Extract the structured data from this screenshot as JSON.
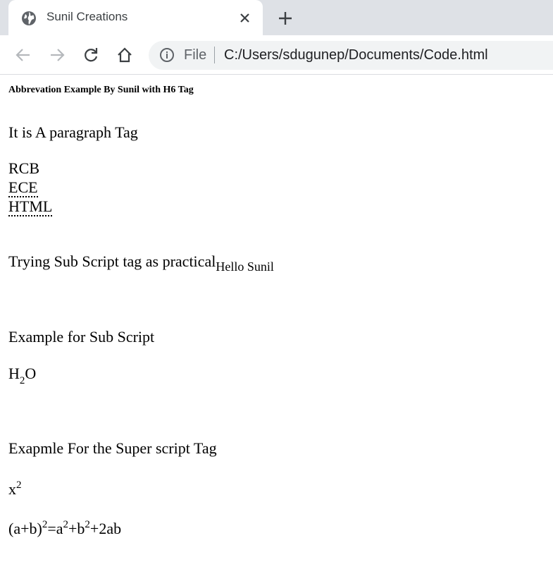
{
  "browser": {
    "tab_title": "Sunil Creations",
    "omnibox_scheme_label": "File",
    "url": "C:/Users/sdugunep/Documents/Code.html"
  },
  "page": {
    "heading_h6": "Abbrevation Example By Sunil with H6 Tag",
    "paragraph": "It is A paragraph Tag",
    "abbr_lines": [
      "RCB",
      "ECE",
      "HTML"
    ],
    "subscript_demo": {
      "text": "Trying Sub Script tag as practical",
      "sub": "Hello Sunil"
    },
    "sub_example_title": "Example for Sub Script",
    "h2o": {
      "h": "H",
      "sub": "2",
      "o": "O"
    },
    "sup_example_title": "Exapmle For the Super script Tag",
    "x_squared": {
      "base": "x",
      "sup": "2"
    },
    "formula": {
      "part1": "(a+b)",
      "sup1": "2",
      "part2": "=a",
      "sup2": "2",
      "part3": "+b",
      "sup3": "2",
      "part4": "+2ab"
    }
  }
}
